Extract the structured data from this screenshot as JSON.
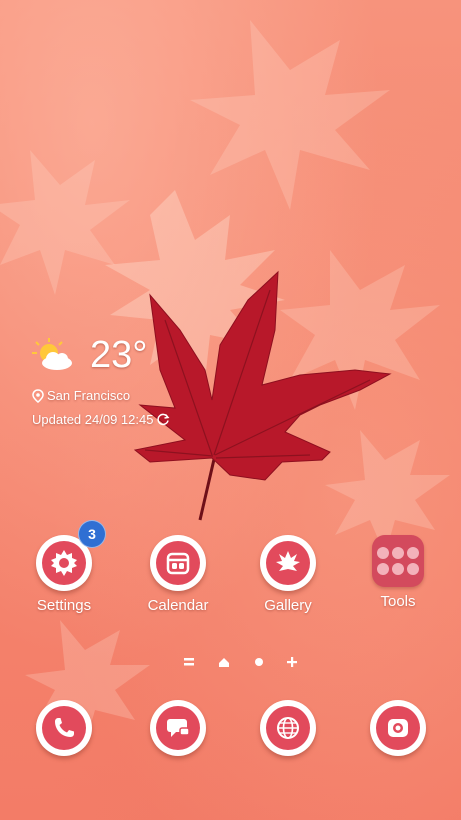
{
  "weather": {
    "temperature": "23°",
    "location": "San Francisco",
    "updated": "Updated 24/09 12:45",
    "icon": "partly-sunny-icon"
  },
  "apps": [
    {
      "label": "Settings",
      "icon": "settings-gear-icon",
      "badge": "3"
    },
    {
      "label": "Calendar",
      "icon": "calendar-icon"
    },
    {
      "label": "Gallery",
      "icon": "gallery-leaf-icon"
    },
    {
      "label": "Tools",
      "icon": "tools-folder-icon"
    }
  ],
  "page_indicator": [
    "menu",
    "home",
    "page-dot",
    "add"
  ],
  "dock": [
    {
      "icon": "phone-icon"
    },
    {
      "icon": "messages-icon"
    },
    {
      "icon": "internet-globe-icon"
    },
    {
      "icon": "camera-icon"
    }
  ],
  "colors": {
    "wallpaper": "#f5866f",
    "icon_accent": "#e24a5c",
    "badge": "#2f6fd3",
    "leaf": "#b8182a"
  }
}
